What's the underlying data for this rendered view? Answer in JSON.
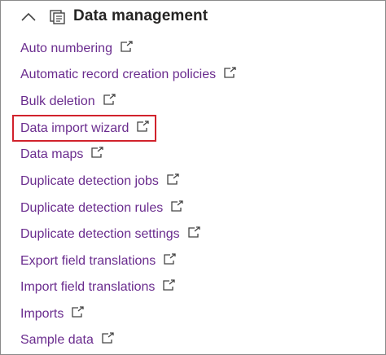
{
  "section": {
    "title": "Data management",
    "collapse_icon": "chevron-up-icon",
    "section_icon": "data-management-icon"
  },
  "items": [
    {
      "label": "Auto numbering",
      "icon": "open-in-new-window-icon"
    },
    {
      "label": "Automatic record creation policies",
      "icon": "open-in-new-window-icon"
    },
    {
      "label": "Bulk deletion",
      "icon": "open-in-new-window-icon"
    },
    {
      "label": "Data import wizard",
      "icon": "open-in-new-window-icon",
      "highlighted": true
    },
    {
      "label": "Data maps",
      "icon": "open-in-new-window-icon"
    },
    {
      "label": "Duplicate detection jobs",
      "icon": "open-in-new-window-icon"
    },
    {
      "label": "Duplicate detection rules",
      "icon": "open-in-new-window-icon"
    },
    {
      "label": "Duplicate detection settings",
      "icon": "open-in-new-window-icon"
    },
    {
      "label": "Export field translations",
      "icon": "open-in-new-window-icon"
    },
    {
      "label": "Import field translations",
      "icon": "open-in-new-window-icon"
    },
    {
      "label": "Imports",
      "icon": "open-in-new-window-icon"
    },
    {
      "label": "Sample data",
      "icon": "open-in-new-window-icon"
    }
  ],
  "colors": {
    "link": "#6a2c8e",
    "title": "#252423",
    "highlight_border": "#d1222c"
  }
}
